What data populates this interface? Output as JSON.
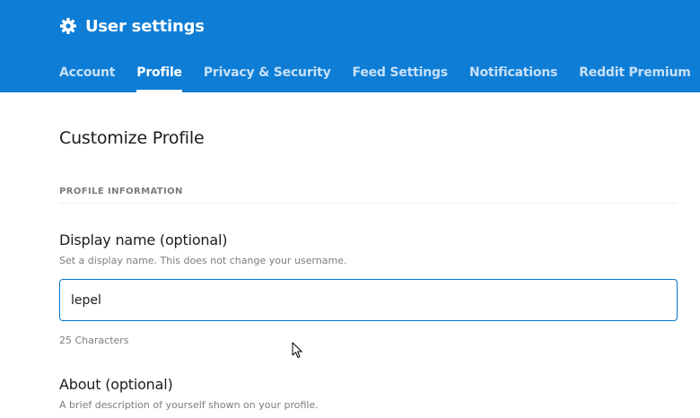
{
  "header": {
    "title": "User settings",
    "icon": "gear-icon",
    "background_color": "#0d7dd6"
  },
  "tabs": [
    {
      "label": "Account",
      "active": false
    },
    {
      "label": "Profile",
      "active": true
    },
    {
      "label": "Privacy & Security",
      "active": false
    },
    {
      "label": "Feed Settings",
      "active": false
    },
    {
      "label": "Notifications",
      "active": false
    },
    {
      "label": "Reddit Premium",
      "active": false
    }
  ],
  "main": {
    "heading": "Customize Profile",
    "section_label": "PROFILE INFORMATION",
    "display_name": {
      "title": "Display name (optional)",
      "description": "Set a display name. This does not change your username.",
      "value": "lepel",
      "char_count": "25 Characters"
    },
    "about": {
      "title": "About (optional)",
      "description": "A brief description of yourself shown on your profile."
    }
  }
}
